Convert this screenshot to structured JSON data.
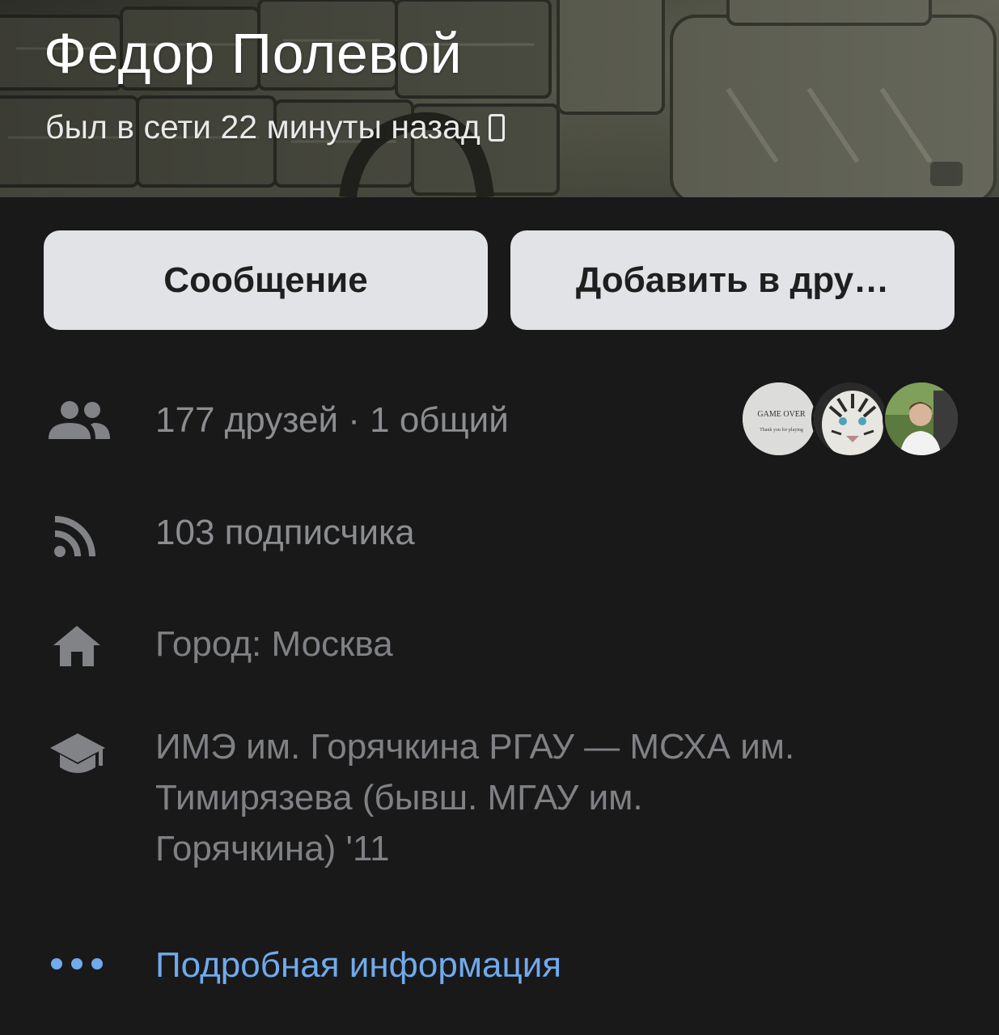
{
  "profile": {
    "name": "Федор Полевой",
    "status": "был в сети 22 минуты назад",
    "status_device_icon": "phone-icon"
  },
  "actions": {
    "message_label": "Сообщение",
    "add_friend_label": "Добавить в дру…"
  },
  "info": {
    "friends": {
      "icon": "friends-icon",
      "text": "177 друзей · 1 общий"
    },
    "followers": {
      "icon": "rss-icon",
      "text": "103 подписчика"
    },
    "city": {
      "icon": "home-icon",
      "text": "Город: Москва"
    },
    "education": {
      "icon": "graduation-cap-icon",
      "text": "ИМЭ им. Горячкина РГАУ — МСХА им. Тимирязева (бывш. МГАУ им. Горячкина) '11"
    },
    "details": {
      "icon": "more-dots-icon",
      "text": "Подробная информация"
    }
  },
  "friend_avatars": [
    {
      "name": "avatar-game-over",
      "caption_line1": "GAME OVER",
      "caption_line2": "Thank you for playing"
    },
    {
      "name": "avatar-white-tiger"
    },
    {
      "name": "avatar-person-in-car"
    }
  ],
  "colors": {
    "background": "#19191a",
    "button_bg": "#e1e3e6",
    "secondary_text": "#7f8184",
    "link": "#71aaeb"
  }
}
